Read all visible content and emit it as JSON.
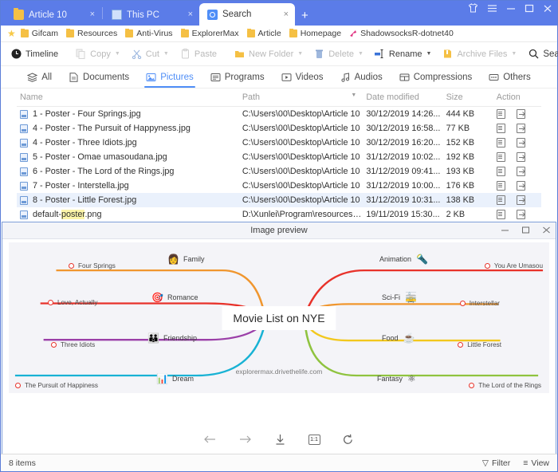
{
  "window": {
    "tabs": [
      {
        "label": "Article 10",
        "icon": "folder-icon",
        "active": false,
        "close": "×"
      },
      {
        "label": "This PC",
        "icon": "computer-icon",
        "active": false,
        "close": "×"
      },
      {
        "label": "Search",
        "icon": "search-icon",
        "active": true,
        "close": "×"
      }
    ],
    "new_tab_label": "+",
    "controls": [
      {
        "name": "theme-icon",
        "glyph": "Θ"
      },
      {
        "name": "menu-icon",
        "glyph": "≡"
      },
      {
        "name": "minimize-icon",
        "glyph": "—"
      },
      {
        "name": "maximize-icon",
        "glyph": "☐"
      },
      {
        "name": "close-icon",
        "glyph": "×"
      }
    ]
  },
  "bookmarks": {
    "star_glyph": "★",
    "items": [
      {
        "label": "Gifcam",
        "icon": "folder-icon"
      },
      {
        "label": "Resources",
        "icon": "folder-icon"
      },
      {
        "label": "Anti-Virus",
        "icon": "folder-icon"
      },
      {
        "label": "ExplorerMax",
        "icon": "folder-icon"
      },
      {
        "label": "Article",
        "icon": "folder-icon"
      },
      {
        "label": "Homepage",
        "icon": "folder-icon"
      },
      {
        "label": "ShadowsocksR-dotnet40",
        "icon": "rocket-icon"
      }
    ]
  },
  "toolbar": {
    "timeline": "Timeline",
    "copy": "Copy",
    "cut": "Cut",
    "paste": "Paste",
    "new_folder": "New Folder",
    "delete": "Delete",
    "rename": "Rename",
    "archive": "Archive Files",
    "search": "Search",
    "caret": "▼",
    "go_glyph": "→"
  },
  "categories": [
    {
      "label": "All",
      "icon": "layers-icon",
      "active": false
    },
    {
      "label": "Documents",
      "icon": "document-icon",
      "active": false
    },
    {
      "label": "Pictures",
      "icon": "picture-icon",
      "active": true
    },
    {
      "label": "Programs",
      "icon": "program-icon",
      "active": false
    },
    {
      "label": "Videos",
      "icon": "video-icon",
      "active": false
    },
    {
      "label": "Audios",
      "icon": "audio-icon",
      "active": false
    },
    {
      "label": "Compressions",
      "icon": "archive-icon",
      "active": false
    },
    {
      "label": "Others",
      "icon": "others-icon",
      "active": false
    }
  ],
  "filelist": {
    "columns": [
      "Name",
      "Path",
      "Date modified",
      "Size",
      "Action"
    ],
    "sort_caret": "▼",
    "rows": [
      {
        "name": "1 - Poster - Four Springs.jpg",
        "path": "C:\\Users\\00\\Desktop\\Article 10",
        "date": "30/12/2019 14:26...",
        "size": "444 KB",
        "selected": false,
        "highlight": ""
      },
      {
        "name": "4 - Poster - The Pursuit of Happyness.jpg",
        "path": "C:\\Users\\00\\Desktop\\Article 10",
        "date": "30/12/2019 16:58...",
        "size": "77 KB",
        "selected": false,
        "highlight": ""
      },
      {
        "name": "4 - Poster - Three Idiots.jpg",
        "path": "C:\\Users\\00\\Desktop\\Article 10",
        "date": "30/12/2019 16:20...",
        "size": "152 KB",
        "selected": false,
        "highlight": ""
      },
      {
        "name": "5 - Poster - Omae umasoudana.jpg",
        "path": "C:\\Users\\00\\Desktop\\Article 10",
        "date": "31/12/2019 10:02...",
        "size": "192 KB",
        "selected": false,
        "highlight": ""
      },
      {
        "name": "6 - Poster - The Lord of the Rings.jpg",
        "path": "C:\\Users\\00\\Desktop\\Article 10",
        "date": "31/12/2019 09:41...",
        "size": "193 KB",
        "selected": false,
        "highlight": ""
      },
      {
        "name": "7 - Poster - Interstella.jpg",
        "path": "C:\\Users\\00\\Desktop\\Article 10",
        "date": "31/12/2019 10:00...",
        "size": "176 KB",
        "selected": false,
        "highlight": ""
      },
      {
        "name": "8 - Poster - Little Forest.jpg",
        "path": "C:\\Users\\00\\Desktop\\Article 10",
        "date": "31/12/2019 10:31...",
        "size": "138 KB",
        "selected": true,
        "highlight": ""
      },
      {
        "name": "default-poster.png",
        "path": "D:\\Xunlei\\Program\\resources\\app\\...",
        "date": "19/11/2019 15:30...",
        "size": "2 KB",
        "selected": false,
        "highlight": "poster"
      }
    ]
  },
  "preview": {
    "title": "Image preview",
    "controls": [
      {
        "name": "minimize-icon",
        "glyph": "—"
      },
      {
        "name": "maximize-icon",
        "glyph": "☐"
      },
      {
        "name": "close-icon",
        "glyph": "×"
      }
    ],
    "nav": [
      {
        "name": "previous-icon",
        "glyph": "←"
      },
      {
        "name": "next-icon",
        "glyph": "→"
      },
      {
        "name": "download-icon",
        "glyph": "⤓"
      },
      {
        "name": "actual-size-icon",
        "glyph": "1:1"
      },
      {
        "name": "rotate-icon",
        "glyph": "↺"
      }
    ],
    "mindmap": {
      "center": "Movie List on NYE",
      "watermark": "explorermax.drivethelife.com",
      "left_branches": [
        {
          "branch": "Family",
          "emoji": "👩",
          "leaf": "Four Springs",
          "color": "#f0962e"
        },
        {
          "branch": "Romance",
          "emoji": "🎯",
          "leaf": "Love, Actually",
          "color": "#e8322a"
        },
        {
          "branch": "Friendship",
          "emoji": "👪",
          "leaf": "Three Idiots",
          "color": "#9b3fa8"
        },
        {
          "branch": "Dream",
          "emoji": "📊",
          "leaf": "The Pursuit of Happiness",
          "color": "#18b2d4"
        }
      ],
      "right_branches": [
        {
          "branch": "Animation",
          "emoji": "🔦",
          "leaf": "You Are Umasou",
          "color": "#e8322a"
        },
        {
          "branch": "Sci-Fi",
          "emoji": "🚋",
          "leaf": "Interstellar",
          "color": "#f0962e"
        },
        {
          "branch": "Food",
          "emoji": "☕",
          "leaf": "Little Forest",
          "color": "#f2c81e"
        },
        {
          "branch": "Fantasy",
          "emoji": "⚛",
          "leaf": "The Lord of the Rings",
          "color": "#8fc33f"
        }
      ]
    }
  },
  "statusbar": {
    "items_count": "8 items",
    "filter": "Filter",
    "view": "View",
    "filter_glyph": "▽",
    "view_glyph": "≡"
  },
  "colors": {
    "titlebar": "#5b7ce8",
    "accent": "#4f8ef7",
    "folder": "#f5c044",
    "selection": "#eaf1fc"
  }
}
